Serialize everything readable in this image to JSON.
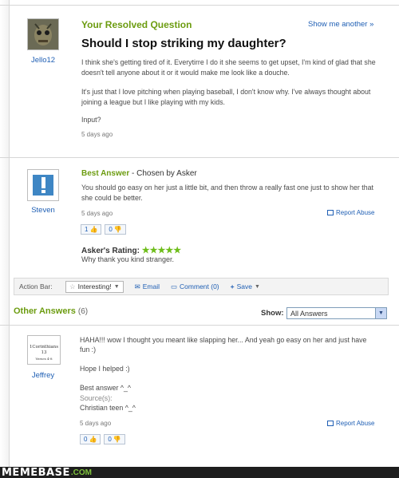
{
  "question": {
    "header": "Your Resolved Question",
    "show_another": "Show me another »",
    "title": "Should I stop striking my daughter?",
    "asker": "Jello12",
    "body_1": "I think she's getting tired of it. Everytirre I do it she seems to get upset, I'm kind of glad that she doesn't tell anyone about it or it would make me look like a douche.",
    "body_2": "It's just that I love pitching when playing baseball, I don't know why. I've always thought about joining a league but I like playing with my kids.",
    "body_3": "Input?",
    "time": "5 days ago"
  },
  "best_answer": {
    "label": "Best Answer",
    "chosen": "- Chosen by Asker",
    "user": "Steven",
    "text": "You should go easy on her just a little bit, and then throw a really fast one just to show her that she could be better.",
    "time": "5 days ago",
    "report": "Report Abuse",
    "thumbs_up": "1",
    "thumbs_down": "0",
    "rating_label": "Asker's Rating:",
    "stars": "★★★★★",
    "rating_comment": "Why thank you kind stranger."
  },
  "action_bar": {
    "label": "Action Bar:",
    "interesting": "Interesting!",
    "email": "Email",
    "comment": "Comment (0)",
    "save": "Save"
  },
  "other_answers": {
    "header": "Other Answers",
    "count": "(6)",
    "show_label": "Show:",
    "filter_value": "All Answers",
    "answer": {
      "user": "Jeffrey",
      "avatar_text": "1Corinthians 13",
      "avatar_sub": "Verses 4-8",
      "line_1": "HAHA!!! wow I thought you meant like slapping her... And yeah go easy on her and just have fun :)",
      "line_2": "Hope I helped :)",
      "line_3": "Best answer ^_^",
      "source_label": "Source(s):",
      "source": "Christian teen ^_^",
      "time": "5 days ago",
      "report": "Report Abuse",
      "thumbs_up": "0",
      "thumbs_down": "0"
    }
  },
  "footer": {
    "brand": "MEMEBASE",
    "dotcom": ".COM"
  },
  "colors": {
    "accent_green": "#6c9c10",
    "link_blue": "#1f5fb4",
    "star_green": "#6ebd1a",
    "footer_bg": "#1e1e1e"
  }
}
